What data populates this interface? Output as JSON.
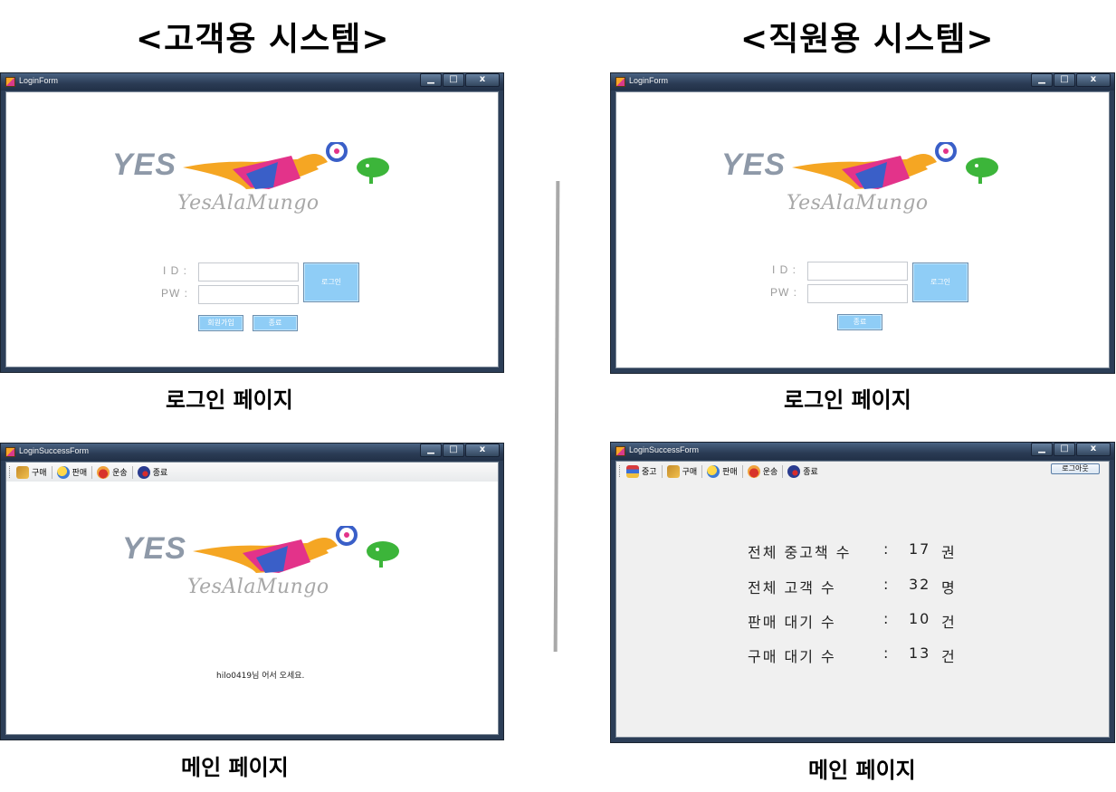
{
  "left_heading": "<고객용 시스템>",
  "right_heading": "<직원용 시스템>",
  "captions": {
    "login_left": "로그인 페이지",
    "login_right": "로그인 페이지",
    "main_left": "메인 페이지",
    "main_right": "메인 페이지"
  },
  "windows": {
    "login_title": "LoginForm",
    "main_title": "LoginSuccessForm",
    "minimize": "▁",
    "maximize": "□",
    "close": "x"
  },
  "logo": {
    "yes": "YES",
    "script": "YesAlaMungo"
  },
  "login_form": {
    "id_label": "I D :",
    "pw_label": "PW :",
    "login_button": "로그인",
    "signup_button": "회원가입",
    "exit_button": "종료"
  },
  "customer_main": {
    "toolbar": [
      "구매",
      "판매",
      "운송",
      "종료"
    ],
    "welcome": "hilo0419님 어서 오세요."
  },
  "employee_main": {
    "toolbar": [
      "중고",
      "구매",
      "판매",
      "운송",
      "종료"
    ],
    "logout_button": "로그아웃",
    "stats": [
      {
        "label": "전체 중고책 수",
        "colon": ":",
        "value": "17",
        "unit": "권"
      },
      {
        "label": "전체 고객 수",
        "colon": ":",
        "value": "32",
        "unit": "명"
      },
      {
        "label": "판매 대기 수",
        "colon": ":",
        "value": "10",
        "unit": "건"
      },
      {
        "label": "구매 대기 수",
        "colon": ":",
        "value": "13",
        "unit": "건"
      }
    ]
  },
  "colors": {
    "titlebar": "#2a3b54",
    "button_blue": "#8fcdf6",
    "divider": "#a9a9a9"
  }
}
